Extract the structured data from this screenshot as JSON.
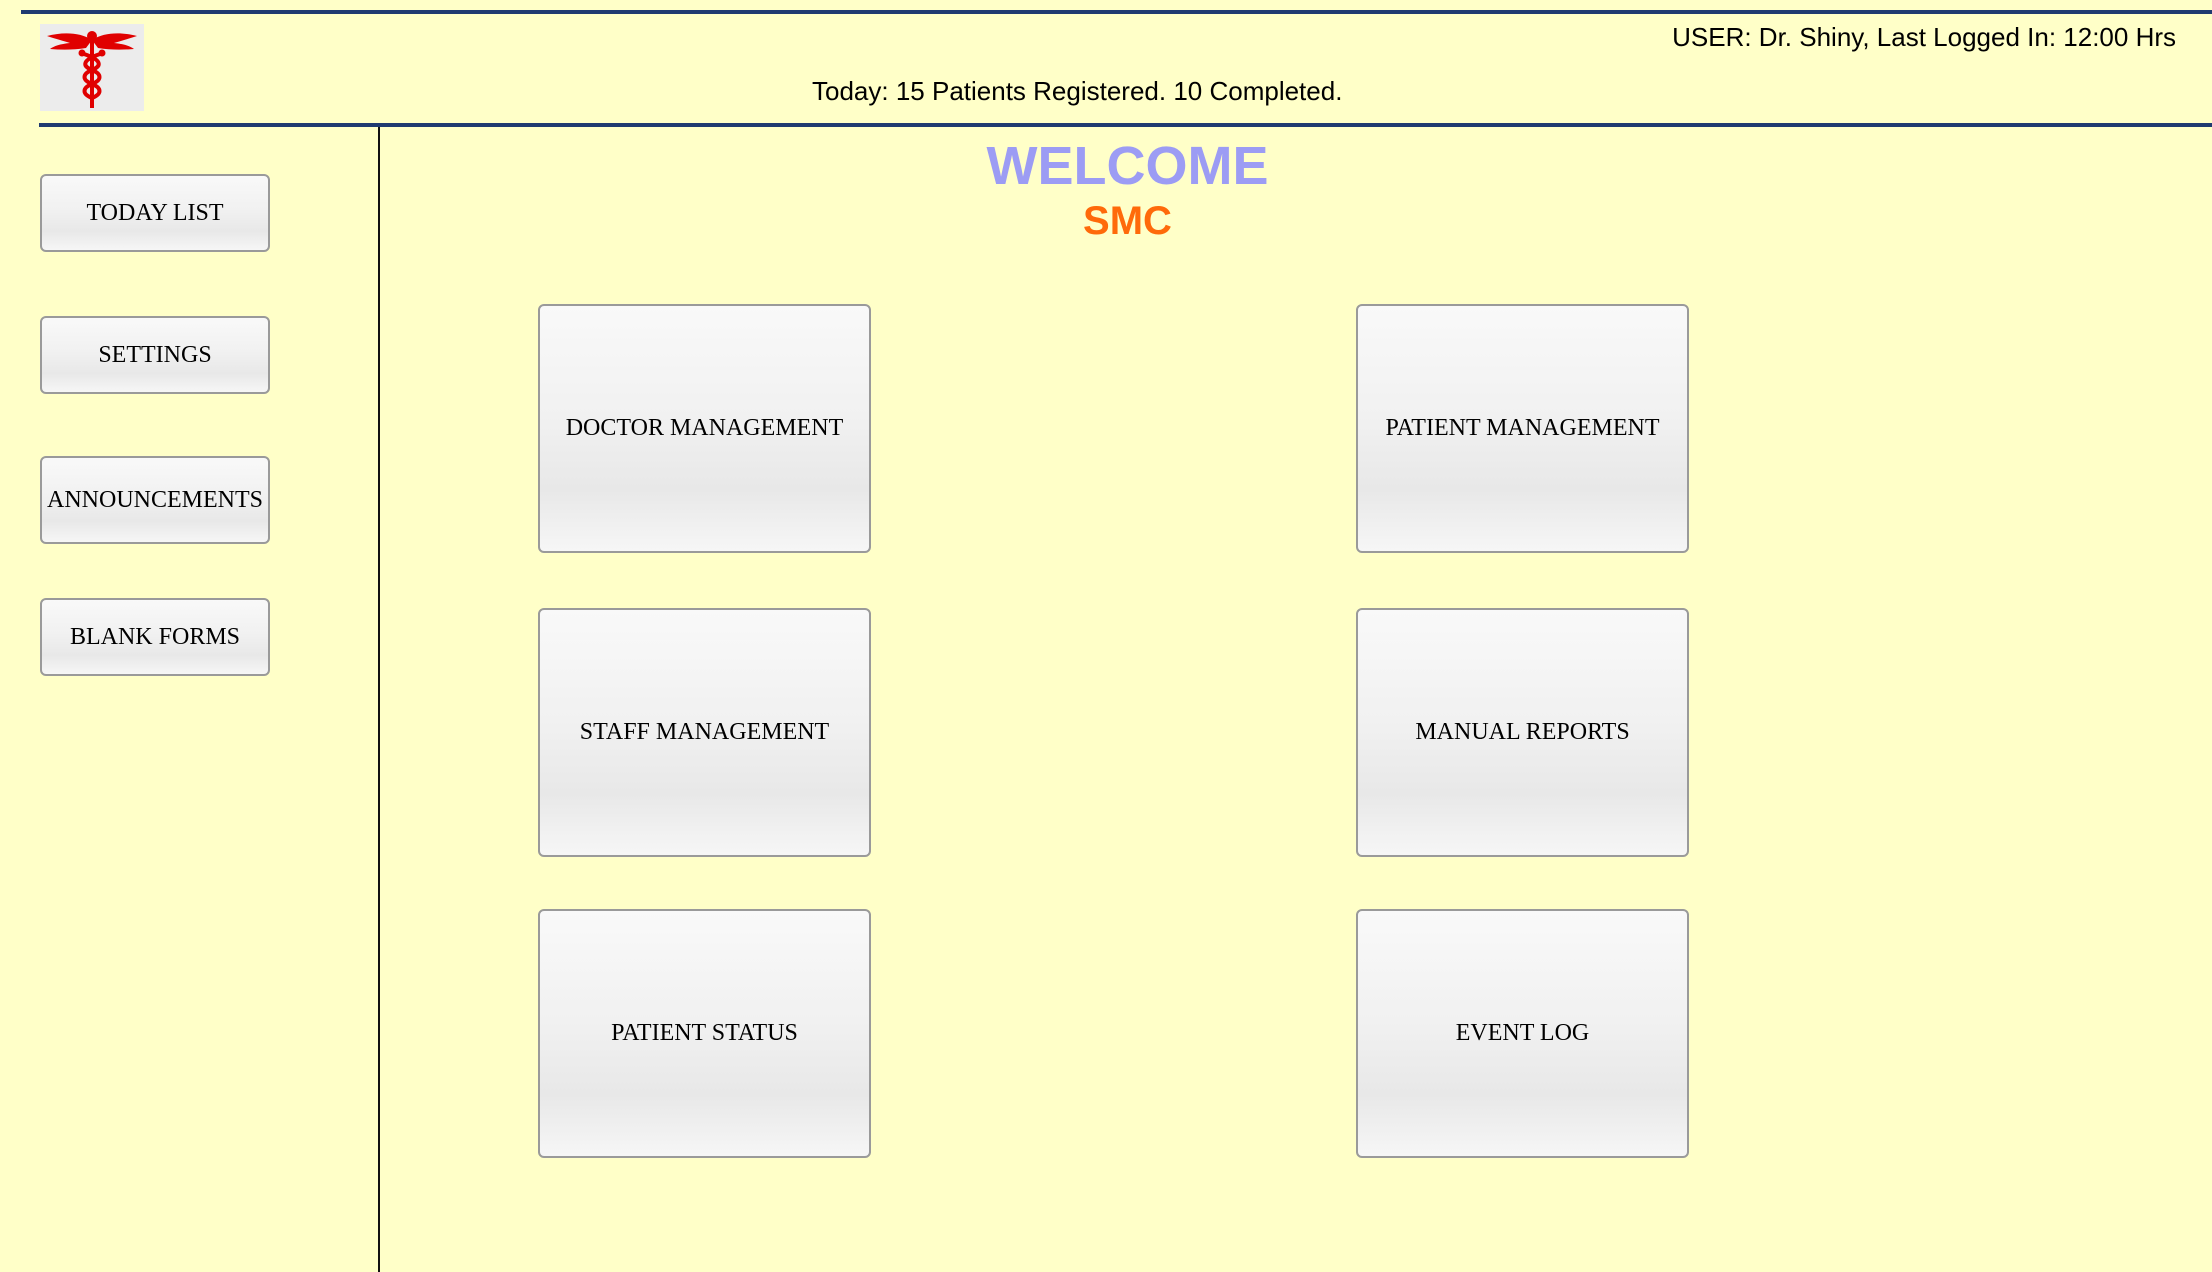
{
  "header": {
    "logo_icon": "caduceus-icon",
    "logo_color": "#e00000",
    "user_info": "USER: Dr. Shiny, Last Logged In: 12:00 Hrs",
    "today_status": "Today: 15 Patients Registered. 10 Completed."
  },
  "sidebar": {
    "items": [
      {
        "label": "TODAY LIST"
      },
      {
        "label": "SETTINGS"
      },
      {
        "label": "ANNOUNCEMENTS"
      },
      {
        "label": "BLANK FORMS"
      }
    ]
  },
  "main": {
    "welcome": "WELCOME",
    "org_name": "SMC",
    "tiles": [
      {
        "label": "DOCTOR MANAGEMENT"
      },
      {
        "label": "PATIENT MANAGEMENT"
      },
      {
        "label": "STAFF MANAGEMENT"
      },
      {
        "label": "MANUAL REPORTS"
      },
      {
        "label": "PATIENT STATUS"
      },
      {
        "label": "EVENT LOG"
      }
    ]
  },
  "colors": {
    "background": "#ffffc8",
    "rule": "#1f3a70",
    "welcome": "#9c9cf4",
    "org": "#ff6a0a"
  }
}
